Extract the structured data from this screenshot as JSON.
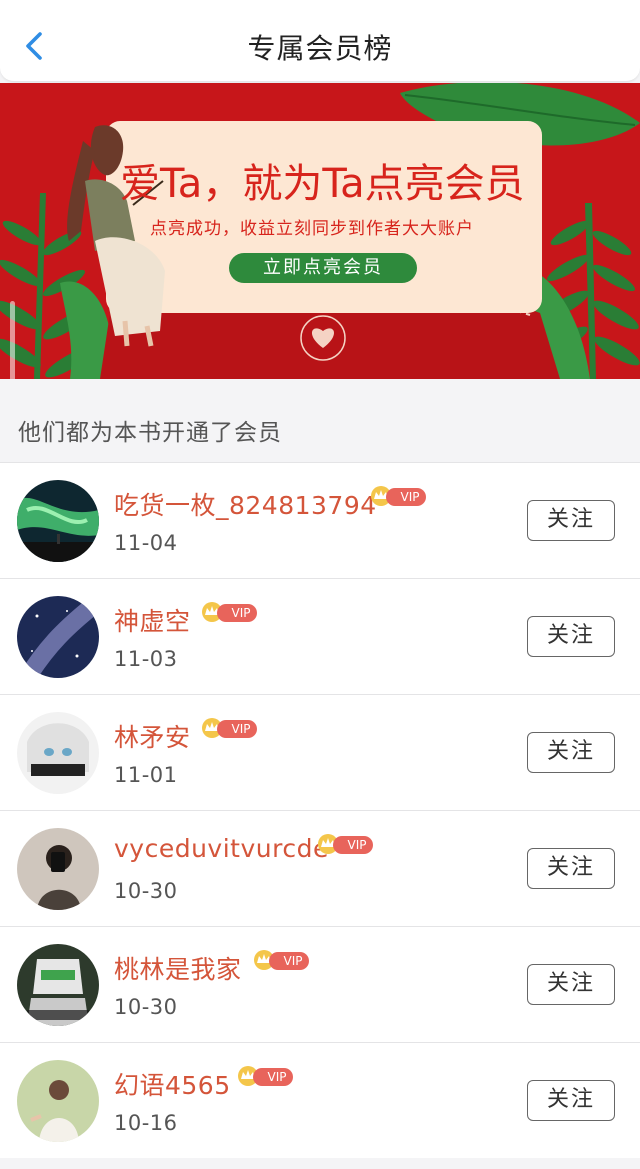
{
  "header": {
    "title": "专属会员榜",
    "back_icon": "chevron-left-icon"
  },
  "banner": {
    "headline": "爱Ta，就为Ta点亮会员",
    "subtitle": "点亮成功，收益立刻同步到作者大大账户",
    "cta": "立即点亮会员",
    "colors": {
      "background": "#c7161a",
      "card": "#fde7d3",
      "button": "#2e8a3c",
      "text": "#d7241c"
    }
  },
  "section": {
    "title": "他们都为本书开通了会员"
  },
  "members": [
    {
      "name": "吃货一枚_824813794",
      "badge": "VIP",
      "date": "11-04",
      "follow": "关注"
    },
    {
      "name": "神虚空",
      "badge": "VIP",
      "date": "11-03",
      "follow": "关注"
    },
    {
      "name": "林矛安",
      "badge": "VIP",
      "date": "11-01",
      "follow": "关注"
    },
    {
      "name": "vyceduvitvurcde",
      "badge": "VIP",
      "date": "10-30",
      "follow": "关注"
    },
    {
      "name": "桃林是我家",
      "badge": "VIP",
      "date": "10-30",
      "follow": "关注"
    },
    {
      "name": "幻语4565",
      "badge": "VIP",
      "date": "10-16",
      "follow": "关注"
    }
  ],
  "colors": {
    "accent": "#2f8de4",
    "name": "#d4553a",
    "vip": "#e8645b"
  }
}
